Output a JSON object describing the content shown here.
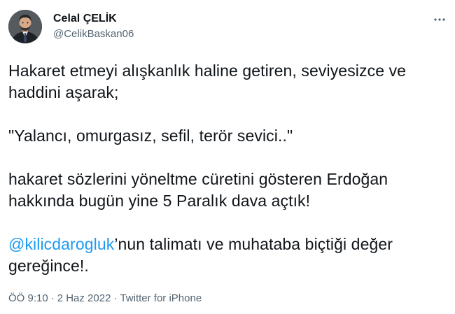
{
  "author": {
    "display_name": "Celal ÇELİK",
    "handle": "@CelikBaskan06",
    "avatar_icon": "profile-photo"
  },
  "more_icon": "more-horizontal-icon",
  "tweet": {
    "line1": "Hakaret etmeyi alışkanlık haline getiren, seviyesizce ve haddini aşarak;",
    "line2": "\"Yalancı, omurgasız, sefil, terör sevici..\"",
    "line3": "hakaret sözlerini yöneltme cüretini gösteren Erdoğan hakkında bugün yine 5 Paralık dava açtık!",
    "mention": "@kilicdarogluk",
    "line4_rest": "’nun talimatı ve muhataba biçtiği değer gereğince!."
  },
  "meta": {
    "time": "ÖÖ 9:10",
    "separator1": "·",
    "date": "2 Haz 2022",
    "separator2": "·",
    "source": "Twitter for iPhone"
  },
  "colors": {
    "text": "#0f1419",
    "secondary": "#536471",
    "link": "#1d9bf0"
  }
}
